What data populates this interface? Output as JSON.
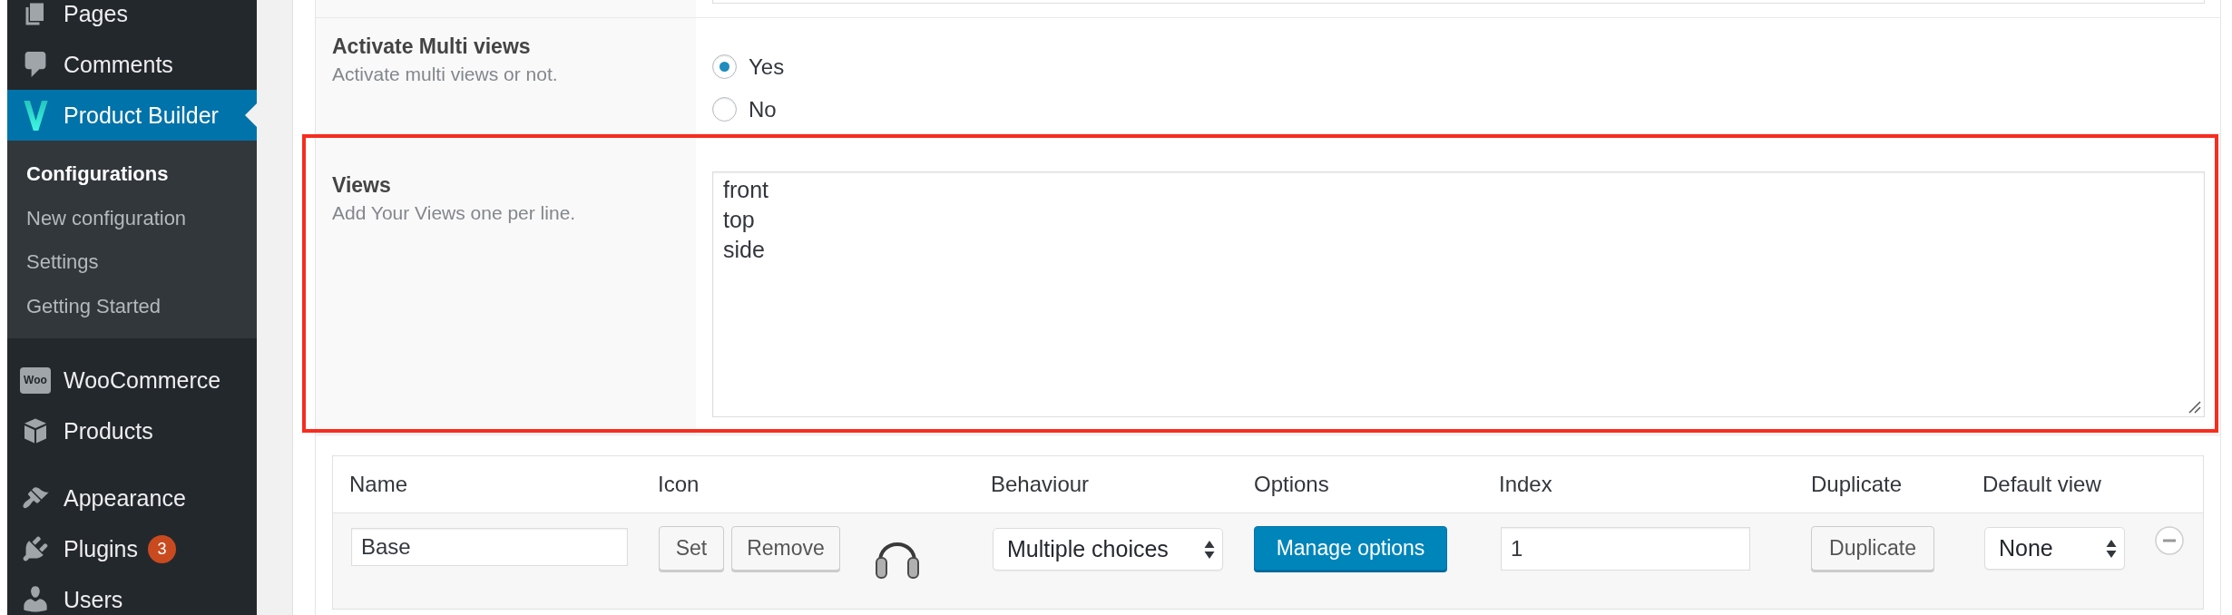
{
  "sidebar": {
    "groups": [
      {
        "items": [
          {
            "label": "Pages",
            "selected": false
          },
          {
            "label": "Comments",
            "selected": false
          },
          {
            "label": "Product Builder",
            "selected": true,
            "children": [
              {
                "label": "Configurations",
                "selected": true
              },
              {
                "label": "New configuration",
                "selected": false
              },
              {
                "label": "Settings",
                "selected": false
              },
              {
                "label": "Getting Started",
                "selected": false
              }
            ]
          }
        ]
      },
      {
        "items": [
          {
            "label": "WooCommerce",
            "selected": false,
            "icon_text": "Woo"
          },
          {
            "label": "Products",
            "selected": false
          }
        ]
      },
      {
        "items": [
          {
            "label": "Appearance",
            "selected": false
          },
          {
            "label": "Plugins",
            "selected": false,
            "badge": "3"
          },
          {
            "label": "Users",
            "selected": false
          }
        ]
      }
    ]
  },
  "settings": {
    "rows": [
      {
        "kind": "text"
      },
      {
        "kind": "radio",
        "label": "Activate Multi views",
        "description": "Activate multi views or not.",
        "options": [
          {
            "label": "Yes",
            "selected": true
          },
          {
            "label": "No",
            "selected": false
          }
        ]
      },
      {
        "kind": "textarea",
        "label": "Views",
        "description": "Add Your Views one per line.",
        "value": "front\ntop\nside",
        "highlighted": true
      }
    ]
  },
  "layers_table": {
    "columns": [
      "Name",
      "Icon",
      "Behaviour",
      "Options",
      "Index",
      "Duplicate",
      "Default view"
    ],
    "rows": [
      {
        "name": "Base",
        "icon_buttons": [
          "Set",
          "Remove"
        ],
        "behaviour": "Multiple choices",
        "options_button": "Manage options",
        "index": "1",
        "duplicate_button": "Duplicate",
        "default_view": "None"
      }
    ]
  }
}
